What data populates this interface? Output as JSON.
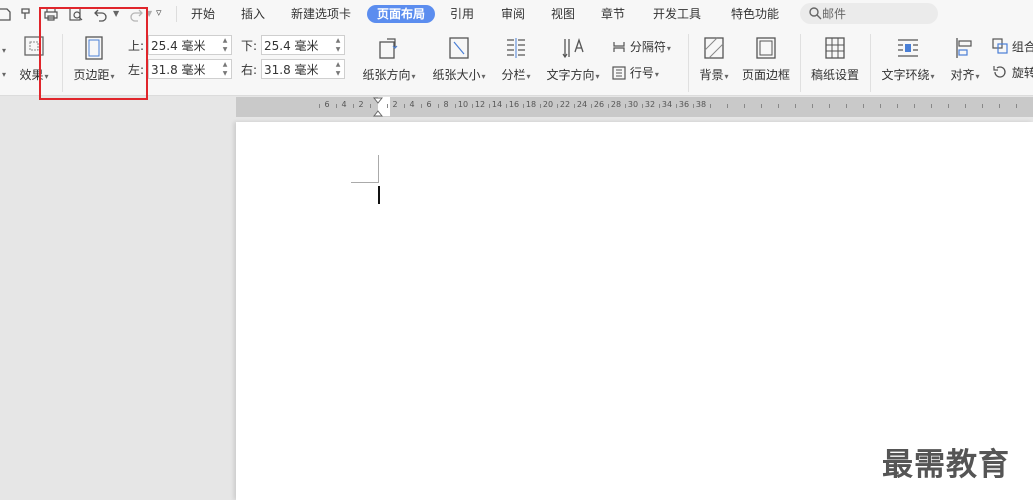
{
  "menu": {
    "tabs": [
      {
        "label": "开始"
      },
      {
        "label": "插入"
      },
      {
        "label": "新建选项卡"
      },
      {
        "label": "页面布局",
        "active": true
      },
      {
        "label": "引用"
      },
      {
        "label": "审阅"
      },
      {
        "label": "视图"
      },
      {
        "label": "章节"
      },
      {
        "label": "开发工具"
      },
      {
        "label": "特色功能"
      }
    ],
    "search_placeholder": "邮件"
  },
  "ribbon": {
    "effects_label": "效果",
    "margins_label": "页边距",
    "margin_top_label": "上:",
    "margin_top_value": "25.4 毫米",
    "margin_bottom_label": "下:",
    "margin_bottom_value": "25.4 毫米",
    "margin_left_label": "左:",
    "margin_left_value": "31.8 毫米",
    "margin_right_label": "右:",
    "margin_right_value": "31.8 毫米",
    "orientation_label": "纸张方向",
    "size_label": "纸张大小",
    "columns_label": "分栏",
    "text_direction_label": "文字方向",
    "breaks_label": "分隔符",
    "line_numbers_label": "行号",
    "background_label": "背景",
    "page_borders_label": "页面边框",
    "manuscript_label": "稿纸设置",
    "text_wrap_label": "文字环绕",
    "align_label": "对齐",
    "group_label": "组合",
    "rotate_label": "旋转"
  },
  "ruler": {
    "left_numbers": [
      "6",
      "4",
      "2"
    ],
    "right_numbers": [
      "2",
      "4",
      "6",
      "8",
      "10",
      "12",
      "14",
      "16",
      "18",
      "20",
      "22",
      "24",
      "26",
      "28",
      "30",
      "32",
      "34",
      "36",
      "38"
    ]
  },
  "watermark": "最需教育",
  "colors": {
    "accent": "#5b8def",
    "highlight": "#e0252b"
  }
}
